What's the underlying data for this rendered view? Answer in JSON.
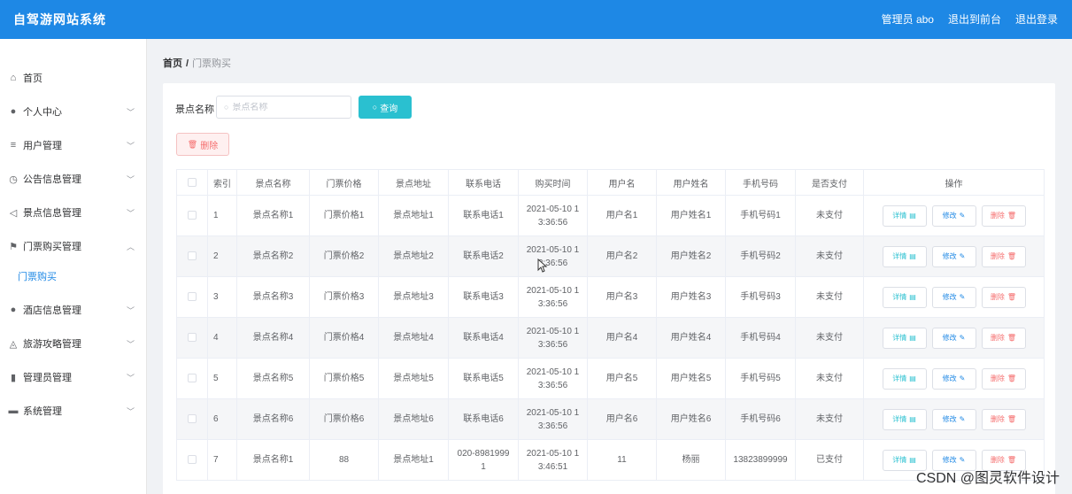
{
  "app": {
    "title": "自驾游网站系统"
  },
  "header": {
    "admin_label": "管理员 abo",
    "front_link": "退出到前台",
    "logout_link": "退出登录"
  },
  "sidebar": {
    "items": [
      {
        "label": "首页",
        "icon": "home-icon",
        "glyph": "⌂"
      },
      {
        "label": "个人中心",
        "icon": "user-icon",
        "glyph": "●"
      },
      {
        "label": "用户管理",
        "icon": "list-icon",
        "glyph": "≡"
      },
      {
        "label": "公告信息管理",
        "icon": "clock-icon",
        "glyph": "◷"
      },
      {
        "label": "景点信息管理",
        "icon": "send-icon",
        "glyph": "◁"
      },
      {
        "label": "门票购买管理",
        "icon": "flag-icon",
        "glyph": "⚑"
      },
      {
        "label": "门票购买",
        "icon": "",
        "glyph": ""
      },
      {
        "label": "酒店信息管理",
        "icon": "person-icon",
        "glyph": "●"
      },
      {
        "label": "旅游攻略管理",
        "icon": "bell-icon",
        "glyph": "◬"
      },
      {
        "label": "管理员管理",
        "icon": "bar-chart-icon",
        "glyph": "▮"
      },
      {
        "label": "系统管理",
        "icon": "chat-icon",
        "glyph": "▬"
      }
    ]
  },
  "breadcrumb": {
    "home": "首页",
    "sep": "/",
    "current": "门票购买"
  },
  "search": {
    "label": "景点名称",
    "placeholder": "景点名称",
    "button": "查询"
  },
  "toolbar": {
    "delete": "删除"
  },
  "table": {
    "headers": [
      "索引",
      "景点名称",
      "门票价格",
      "景点地址",
      "联系电话",
      "购买时间",
      "用户名",
      "用户姓名",
      "手机号码",
      "是否支付",
      "操作"
    ],
    "ops": {
      "detail": "详情",
      "edit": "修改",
      "delete": "删除"
    },
    "rows": [
      {
        "idx": "1",
        "name": "景点名称1",
        "price": "门票价格1",
        "addr": "景点地址1",
        "phone": "联系电话1",
        "time1": "2021-05-10 1",
        "time2": "3:36:56",
        "user": "用户名1",
        "uname": "用户姓名1",
        "mobile": "手机号码1",
        "paid": "未支付"
      },
      {
        "idx": "2",
        "name": "景点名称2",
        "price": "门票价格2",
        "addr": "景点地址2",
        "phone": "联系电话2",
        "time1": "2021-05-10 1",
        "time2": "3:36:56",
        "user": "用户名2",
        "uname": "用户姓名2",
        "mobile": "手机号码2",
        "paid": "未支付"
      },
      {
        "idx": "3",
        "name": "景点名称3",
        "price": "门票价格3",
        "addr": "景点地址3",
        "phone": "联系电话3",
        "time1": "2021-05-10 1",
        "time2": "3:36:56",
        "user": "用户名3",
        "uname": "用户姓名3",
        "mobile": "手机号码3",
        "paid": "未支付"
      },
      {
        "idx": "4",
        "name": "景点名称4",
        "price": "门票价格4",
        "addr": "景点地址4",
        "phone": "联系电话4",
        "time1": "2021-05-10 1",
        "time2": "3:36:56",
        "user": "用户名4",
        "uname": "用户姓名4",
        "mobile": "手机号码4",
        "paid": "未支付"
      },
      {
        "idx": "5",
        "name": "景点名称5",
        "price": "门票价格5",
        "addr": "景点地址5",
        "phone": "联系电话5",
        "time1": "2021-05-10 1",
        "time2": "3:36:56",
        "user": "用户名5",
        "uname": "用户姓名5",
        "mobile": "手机号码5",
        "paid": "未支付"
      },
      {
        "idx": "6",
        "name": "景点名称6",
        "price": "门票价格6",
        "addr": "景点地址6",
        "phone": "联系电话6",
        "time1": "2021-05-10 1",
        "time2": "3:36:56",
        "user": "用户名6",
        "uname": "用户姓名6",
        "mobile": "手机号码6",
        "paid": "未支付"
      },
      {
        "idx": "7",
        "name": "景点名称1",
        "price": "88",
        "addr": "景点地址1",
        "phone": "020-8981999",
        "phone2": "1",
        "time1": "2021-05-10 1",
        "time2": "3:46:51",
        "user": "11",
        "uname": "杨丽",
        "mobile": "13823899999",
        "paid": "已支付"
      }
    ]
  },
  "watermark": "CSDN @图灵软件设计",
  "colors": {
    "header": "#1e88e5",
    "query": "#2ac0d0",
    "danger": "#f56c6c"
  }
}
